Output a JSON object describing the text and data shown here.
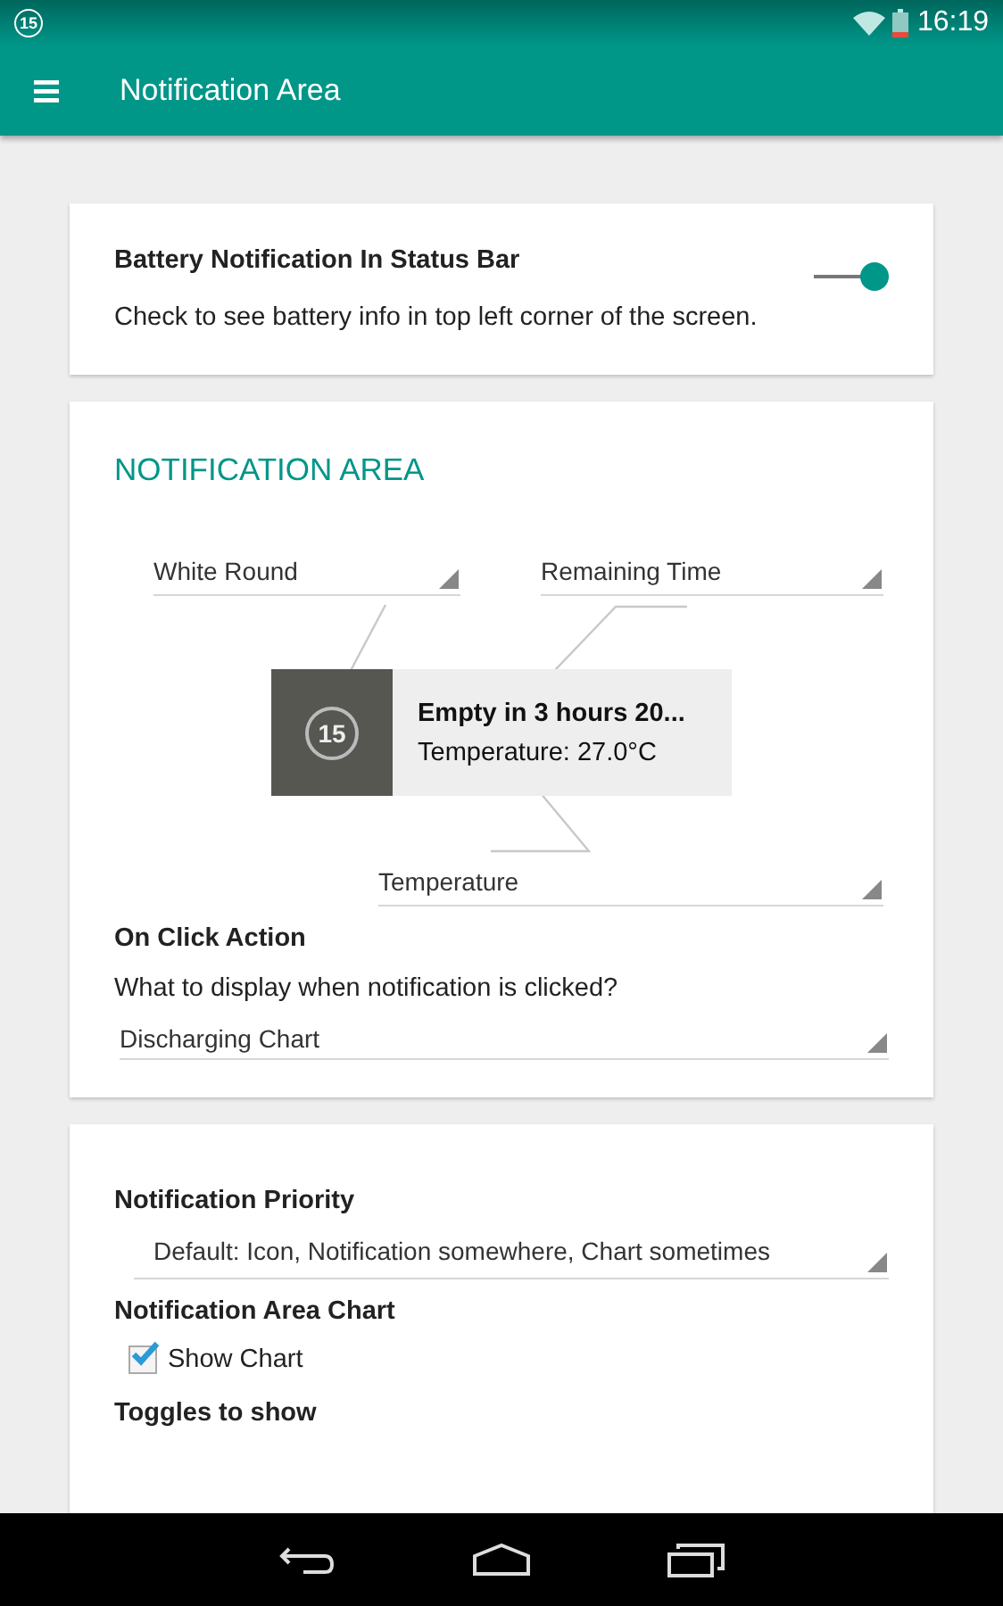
{
  "status_bar": {
    "badge": "15",
    "time": "16:19"
  },
  "app_bar": {
    "title": "Notification Area"
  },
  "battery_card": {
    "title": "Battery Notification In Status Bar",
    "description": "Check to see battery info in top left corner of the screen.",
    "on": true
  },
  "notification_area": {
    "heading": "NOTIFICATION AREA",
    "icon_style": {
      "value": "White Round"
    },
    "first_line": {
      "value": "Remaining Time"
    },
    "second_line": {
      "value": "Temperature"
    },
    "preview": {
      "icon_text": "15",
      "line_1": "Empty in 3 hours 20...",
      "line_2": "Temperature: 27.0°C"
    },
    "on_click": {
      "title": "On Click Action",
      "description": "What to display when notification is clicked?",
      "value": "Discharging Chart"
    }
  },
  "settings_card": {
    "priority": {
      "title": "Notification Priority",
      "value": "Default: Icon, Notification somewhere, Chart sometimes"
    },
    "chart": {
      "title": "Notification Area Chart",
      "checkbox": {
        "label": "Show Chart",
        "checked": true
      }
    },
    "toggles": {
      "title": "Toggles to show"
    }
  }
}
